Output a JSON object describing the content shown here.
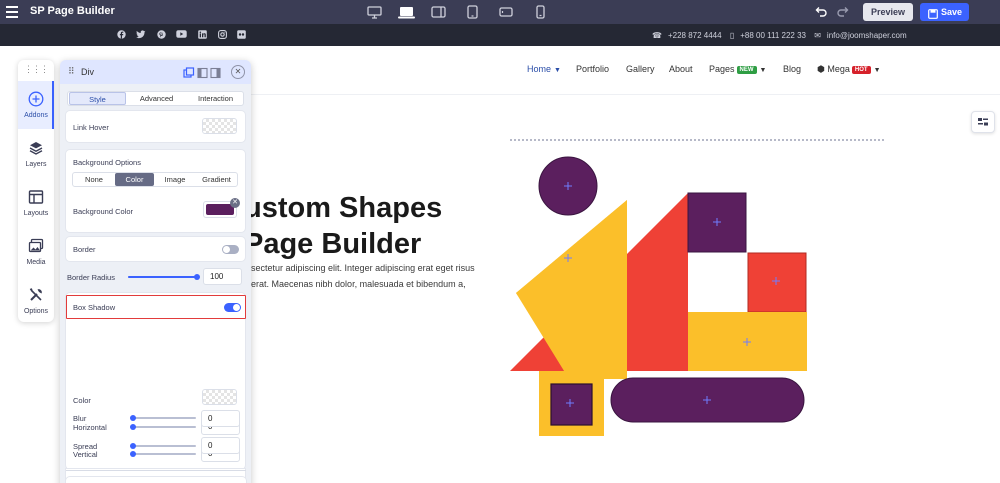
{
  "app": {
    "title": "SP Page Builder",
    "preview_label": "Preview",
    "save_label": "Save"
  },
  "topbar": {
    "devices": [
      "desktop-icon",
      "laptop-icon",
      "tablet-landscape-icon",
      "tablet-icon",
      "mobile-landscape-icon",
      "mobile-icon"
    ],
    "active_device": "laptop-icon"
  },
  "infobar": {
    "social": [
      "facebook",
      "twitter",
      "pinterest",
      "youtube",
      "linkedin",
      "instagram",
      "flickr"
    ],
    "phone1": "+228 872 4444",
    "phone2": "+88 00 111 222 33",
    "email": "info@joomshaper.com"
  },
  "nav": {
    "home": "Home",
    "portfolio": "Portfolio",
    "gallery": "Gallery",
    "about": "About",
    "pages": "Pages",
    "pages_badge": "NEW",
    "blog": "Blog",
    "mega": "Mega",
    "mega_badge": "HOT",
    "colors": {
      "new": "#2f9e44",
      "hot": "#d6212b",
      "active": "#2b4ea8"
    }
  },
  "hero": {
    "title_line1": "ustom Shapes",
    "title_line2": "Page Builder",
    "text_line1": "sectetur adipiscing elit. Integer adipiscing erat eget risus",
    "text_line2": "erat. Maecenas nibh dolor, malesuada et bibendum a,"
  },
  "shapes": {
    "colors": {
      "purple": "#5b1f5e",
      "red": "#ef4136",
      "yellow": "#fbbf2a"
    }
  },
  "rail": {
    "items": [
      {
        "label": "Addons",
        "icon": "plus-circle-icon",
        "active": true
      },
      {
        "label": "Layers",
        "icon": "layers-icon"
      },
      {
        "label": "Layouts",
        "icon": "layout-icon"
      },
      {
        "label": "Media",
        "icon": "media-icon"
      },
      {
        "label": "Options",
        "icon": "tools-icon"
      }
    ]
  },
  "panel": {
    "title": "Div",
    "tabs": [
      "Style",
      "Advanced",
      "Interaction"
    ],
    "active_tab": "Style",
    "link_hover_label": "Link Hover",
    "bg_options_label": "Background Options",
    "bg_types": [
      "None",
      "Color",
      "Image",
      "Gradient"
    ],
    "bg_active": "Color",
    "bg_color_label": "Background Color",
    "bg_color_value": "#5b1f5e",
    "border_label": "Border",
    "border_enabled": false,
    "radius_label": "Border Radius",
    "radius_value": "100",
    "shadow_label": "Box Shadow",
    "shadow_enabled": true,
    "color_label": "Color",
    "horizontal_label": "Horizontal",
    "horizontal_value": "0",
    "vertical_label": "Vertical",
    "vertical_value": "0",
    "blur_label": "Blur",
    "blur_value": "0",
    "spread_label": "Spread",
    "spread_value": "0"
  }
}
